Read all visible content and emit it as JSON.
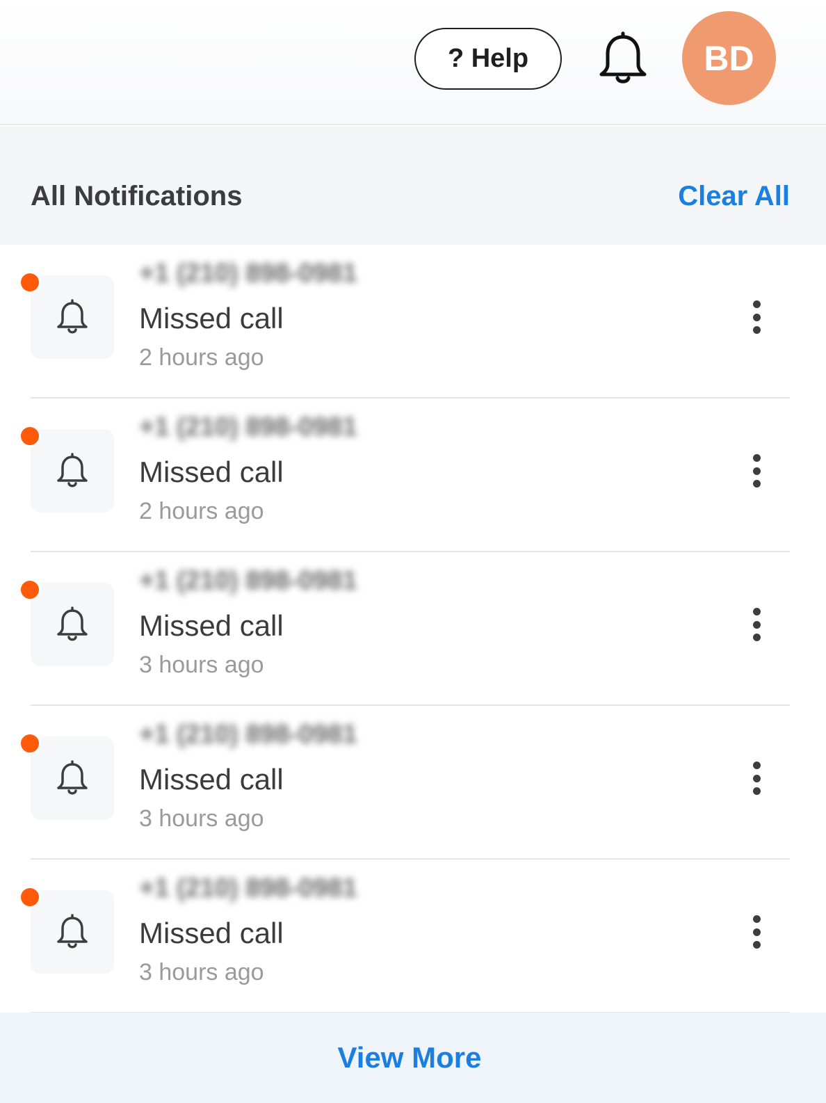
{
  "topbar": {
    "help_label": "? Help",
    "bell_icon": "bell-icon",
    "avatar_initials": "BD",
    "avatar_color": "#ef9a6f"
  },
  "panel": {
    "title": "All Notifications",
    "clear_all_label": "Clear All",
    "accent_color": "#1a7fe0",
    "unread_dot_color": "#ff5a0a"
  },
  "notifications": [
    {
      "phone": "+1 (210) 898-0981",
      "title": "Missed call",
      "time": "2 hours ago",
      "unread": true,
      "icon": "bell-icon"
    },
    {
      "phone": "+1 (210) 898-0981",
      "title": "Missed call",
      "time": "2 hours ago",
      "unread": true,
      "icon": "bell-icon"
    },
    {
      "phone": "+1 (210) 898-0981",
      "title": "Missed call",
      "time": "3 hours ago",
      "unread": true,
      "icon": "bell-icon"
    },
    {
      "phone": "+1 (210) 898-0981",
      "title": "Missed call",
      "time": "3 hours ago",
      "unread": true,
      "icon": "bell-icon"
    },
    {
      "phone": "+1 (210) 898-0981",
      "title": "Missed call",
      "time": "3 hours ago",
      "unread": true,
      "icon": "bell-icon"
    }
  ],
  "footer": {
    "view_more_label": "View More"
  }
}
